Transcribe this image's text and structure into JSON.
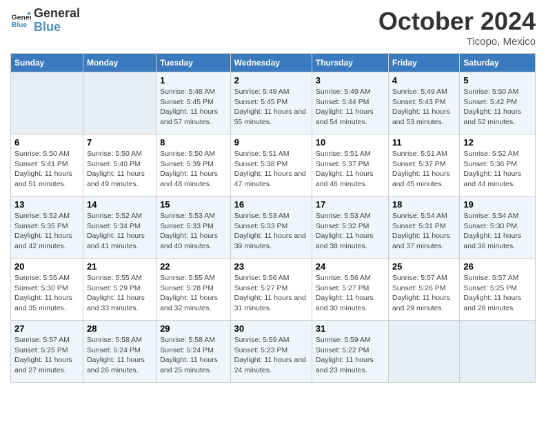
{
  "header": {
    "logo_general": "General",
    "logo_blue": "Blue",
    "month_title": "October 2024",
    "location": "Ticopo, Mexico"
  },
  "days_of_week": [
    "Sunday",
    "Monday",
    "Tuesday",
    "Wednesday",
    "Thursday",
    "Friday",
    "Saturday"
  ],
  "weeks": [
    [
      {
        "day": "",
        "info": ""
      },
      {
        "day": "",
        "info": ""
      },
      {
        "day": "1",
        "info": "Sunrise: 5:48 AM\nSunset: 5:45 PM\nDaylight: 11 hours and 57 minutes."
      },
      {
        "day": "2",
        "info": "Sunrise: 5:49 AM\nSunset: 5:45 PM\nDaylight: 11 hours and 55 minutes."
      },
      {
        "day": "3",
        "info": "Sunrise: 5:49 AM\nSunset: 5:44 PM\nDaylight: 11 hours and 54 minutes."
      },
      {
        "day": "4",
        "info": "Sunrise: 5:49 AM\nSunset: 5:43 PM\nDaylight: 11 hours and 53 minutes."
      },
      {
        "day": "5",
        "info": "Sunrise: 5:50 AM\nSunset: 5:42 PM\nDaylight: 11 hours and 52 minutes."
      }
    ],
    [
      {
        "day": "6",
        "info": "Sunrise: 5:50 AM\nSunset: 5:41 PM\nDaylight: 11 hours and 51 minutes."
      },
      {
        "day": "7",
        "info": "Sunrise: 5:50 AM\nSunset: 5:40 PM\nDaylight: 11 hours and 49 minutes."
      },
      {
        "day": "8",
        "info": "Sunrise: 5:50 AM\nSunset: 5:39 PM\nDaylight: 11 hours and 48 minutes."
      },
      {
        "day": "9",
        "info": "Sunrise: 5:51 AM\nSunset: 5:38 PM\nDaylight: 11 hours and 47 minutes."
      },
      {
        "day": "10",
        "info": "Sunrise: 5:51 AM\nSunset: 5:37 PM\nDaylight: 11 hours and 46 minutes."
      },
      {
        "day": "11",
        "info": "Sunrise: 5:51 AM\nSunset: 5:37 PM\nDaylight: 11 hours and 45 minutes."
      },
      {
        "day": "12",
        "info": "Sunrise: 5:52 AM\nSunset: 5:36 PM\nDaylight: 11 hours and 44 minutes."
      }
    ],
    [
      {
        "day": "13",
        "info": "Sunrise: 5:52 AM\nSunset: 5:35 PM\nDaylight: 11 hours and 42 minutes."
      },
      {
        "day": "14",
        "info": "Sunrise: 5:52 AM\nSunset: 5:34 PM\nDaylight: 11 hours and 41 minutes."
      },
      {
        "day": "15",
        "info": "Sunrise: 5:53 AM\nSunset: 5:33 PM\nDaylight: 11 hours and 40 minutes."
      },
      {
        "day": "16",
        "info": "Sunrise: 5:53 AM\nSunset: 5:33 PM\nDaylight: 11 hours and 39 minutes."
      },
      {
        "day": "17",
        "info": "Sunrise: 5:53 AM\nSunset: 5:32 PM\nDaylight: 11 hours and 38 minutes."
      },
      {
        "day": "18",
        "info": "Sunrise: 5:54 AM\nSunset: 5:31 PM\nDaylight: 11 hours and 37 minutes."
      },
      {
        "day": "19",
        "info": "Sunrise: 5:54 AM\nSunset: 5:30 PM\nDaylight: 11 hours and 36 minutes."
      }
    ],
    [
      {
        "day": "20",
        "info": "Sunrise: 5:55 AM\nSunset: 5:30 PM\nDaylight: 11 hours and 35 minutes."
      },
      {
        "day": "21",
        "info": "Sunrise: 5:55 AM\nSunset: 5:29 PM\nDaylight: 11 hours and 33 minutes."
      },
      {
        "day": "22",
        "info": "Sunrise: 5:55 AM\nSunset: 5:28 PM\nDaylight: 11 hours and 32 minutes."
      },
      {
        "day": "23",
        "info": "Sunrise: 5:56 AM\nSunset: 5:27 PM\nDaylight: 11 hours and 31 minutes."
      },
      {
        "day": "24",
        "info": "Sunrise: 5:56 AM\nSunset: 5:27 PM\nDaylight: 11 hours and 30 minutes."
      },
      {
        "day": "25",
        "info": "Sunrise: 5:57 AM\nSunset: 5:26 PM\nDaylight: 11 hours and 29 minutes."
      },
      {
        "day": "26",
        "info": "Sunrise: 5:57 AM\nSunset: 5:25 PM\nDaylight: 11 hours and 28 minutes."
      }
    ],
    [
      {
        "day": "27",
        "info": "Sunrise: 5:57 AM\nSunset: 5:25 PM\nDaylight: 11 hours and 27 minutes."
      },
      {
        "day": "28",
        "info": "Sunrise: 5:58 AM\nSunset: 5:24 PM\nDaylight: 11 hours and 26 minutes."
      },
      {
        "day": "29",
        "info": "Sunrise: 5:58 AM\nSunset: 5:24 PM\nDaylight: 11 hours and 25 minutes."
      },
      {
        "day": "30",
        "info": "Sunrise: 5:59 AM\nSunset: 5:23 PM\nDaylight: 11 hours and 24 minutes."
      },
      {
        "day": "31",
        "info": "Sunrise: 5:59 AM\nSunset: 5:22 PM\nDaylight: 11 hours and 23 minutes."
      },
      {
        "day": "",
        "info": ""
      },
      {
        "day": "",
        "info": ""
      }
    ]
  ]
}
